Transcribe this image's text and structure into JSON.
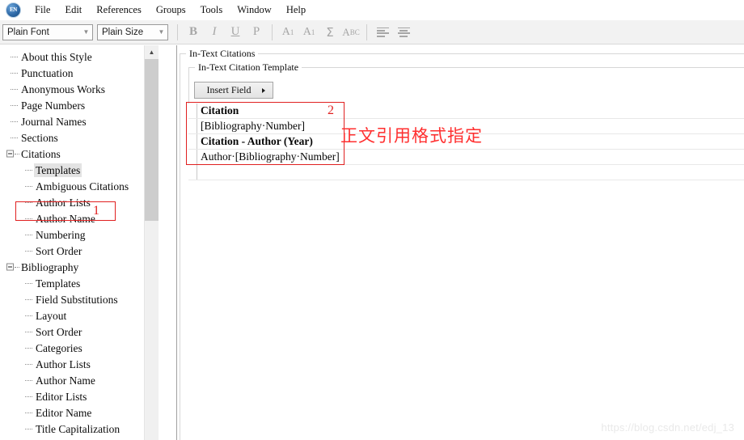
{
  "app": {
    "icon": "endnote-app-icon",
    "watermark": "https://blog.csdn.net/edj_13"
  },
  "menubar": {
    "items": [
      {
        "label": "File"
      },
      {
        "label": "Edit"
      },
      {
        "label": "References"
      },
      {
        "label": "Groups"
      },
      {
        "label": "Tools"
      },
      {
        "label": "Window"
      },
      {
        "label": "Help"
      }
    ]
  },
  "toolbar": {
    "font_combo": {
      "value": "Plain Font",
      "icon": "chevron-down-icon"
    },
    "size_combo": {
      "value": "Plain Size",
      "icon": "chevron-down-icon"
    },
    "buttons": [
      {
        "name": "bold-button",
        "label": "B"
      },
      {
        "name": "italic-button",
        "label": "I"
      },
      {
        "name": "underline-button",
        "label": "U"
      },
      {
        "name": "plain-button",
        "label": "P"
      },
      {
        "name": "superscript-button",
        "label": "A",
        "script": "1"
      },
      {
        "name": "subscript-button",
        "label": "A",
        "script": "1"
      },
      {
        "name": "symbol-button",
        "label": "Σ"
      },
      {
        "name": "spellcheck-button",
        "label": "A",
        "small": "BC"
      },
      {
        "name": "align-left-button",
        "label": ""
      },
      {
        "name": "align-center-button",
        "label": ""
      }
    ]
  },
  "sidebar": {
    "scrollbar": {
      "up_arrow": "chevron-up-icon"
    },
    "items": [
      {
        "label": "About this Style",
        "level": 1,
        "selected": false,
        "expander": null
      },
      {
        "label": "Punctuation",
        "level": 1,
        "selected": false,
        "expander": null
      },
      {
        "label": "Anonymous Works",
        "level": 1,
        "selected": false,
        "expander": null
      },
      {
        "label": "Page Numbers",
        "level": 1,
        "selected": false,
        "expander": null
      },
      {
        "label": "Journal Names",
        "level": 1,
        "selected": false,
        "expander": null
      },
      {
        "label": "Sections",
        "level": 1,
        "selected": false,
        "expander": null
      },
      {
        "label": "Citations",
        "level": 0,
        "selected": false,
        "expander": "collapse"
      },
      {
        "label": "Templates",
        "level": 2,
        "selected": true,
        "expander": null
      },
      {
        "label": "Ambiguous Citations",
        "level": 2,
        "selected": false,
        "expander": null
      },
      {
        "label": "Author Lists",
        "level": 2,
        "selected": false,
        "expander": null
      },
      {
        "label": "Author Name",
        "level": 2,
        "selected": false,
        "expander": null
      },
      {
        "label": "Numbering",
        "level": 2,
        "selected": false,
        "expander": null
      },
      {
        "label": "Sort Order",
        "level": 2,
        "selected": false,
        "expander": null
      },
      {
        "label": "Bibliography",
        "level": 0,
        "selected": false,
        "expander": "collapse"
      },
      {
        "label": "Templates",
        "level": 2,
        "selected": false,
        "expander": null
      },
      {
        "label": "Field Substitutions",
        "level": 2,
        "selected": false,
        "expander": null
      },
      {
        "label": "Layout",
        "level": 2,
        "selected": false,
        "expander": null
      },
      {
        "label": "Sort Order",
        "level": 2,
        "selected": false,
        "expander": null
      },
      {
        "label": "Categories",
        "level": 2,
        "selected": false,
        "expander": null
      },
      {
        "label": "Author Lists",
        "level": 2,
        "selected": false,
        "expander": null
      },
      {
        "label": "Author Name",
        "level": 2,
        "selected": false,
        "expander": null
      },
      {
        "label": "Editor Lists",
        "level": 2,
        "selected": false,
        "expander": null
      },
      {
        "label": "Editor Name",
        "level": 2,
        "selected": false,
        "expander": null
      },
      {
        "label": "Title Capitalization",
        "level": 2,
        "selected": false,
        "expander": null
      }
    ]
  },
  "main": {
    "outer_group_label": "In-Text Citations",
    "inner_group_label": "In-Text Citation Template",
    "insert_field_button": {
      "label": "Insert Field",
      "icon": "caret-right-icon"
    },
    "template_rows": [
      {
        "text": "Citation",
        "header": true
      },
      {
        "text": "[Bibliography·Number]",
        "header": false
      },
      {
        "text": "Citation - Author (Year)",
        "header": true
      },
      {
        "text": "Author·[Bibliography·Number]",
        "header": false
      },
      {
        "text": "",
        "header": false
      }
    ]
  },
  "annotations": {
    "marker_1": "1",
    "marker_2": "2",
    "chinese_note": "正文引用格式指定",
    "accent_color": "#e02020"
  }
}
